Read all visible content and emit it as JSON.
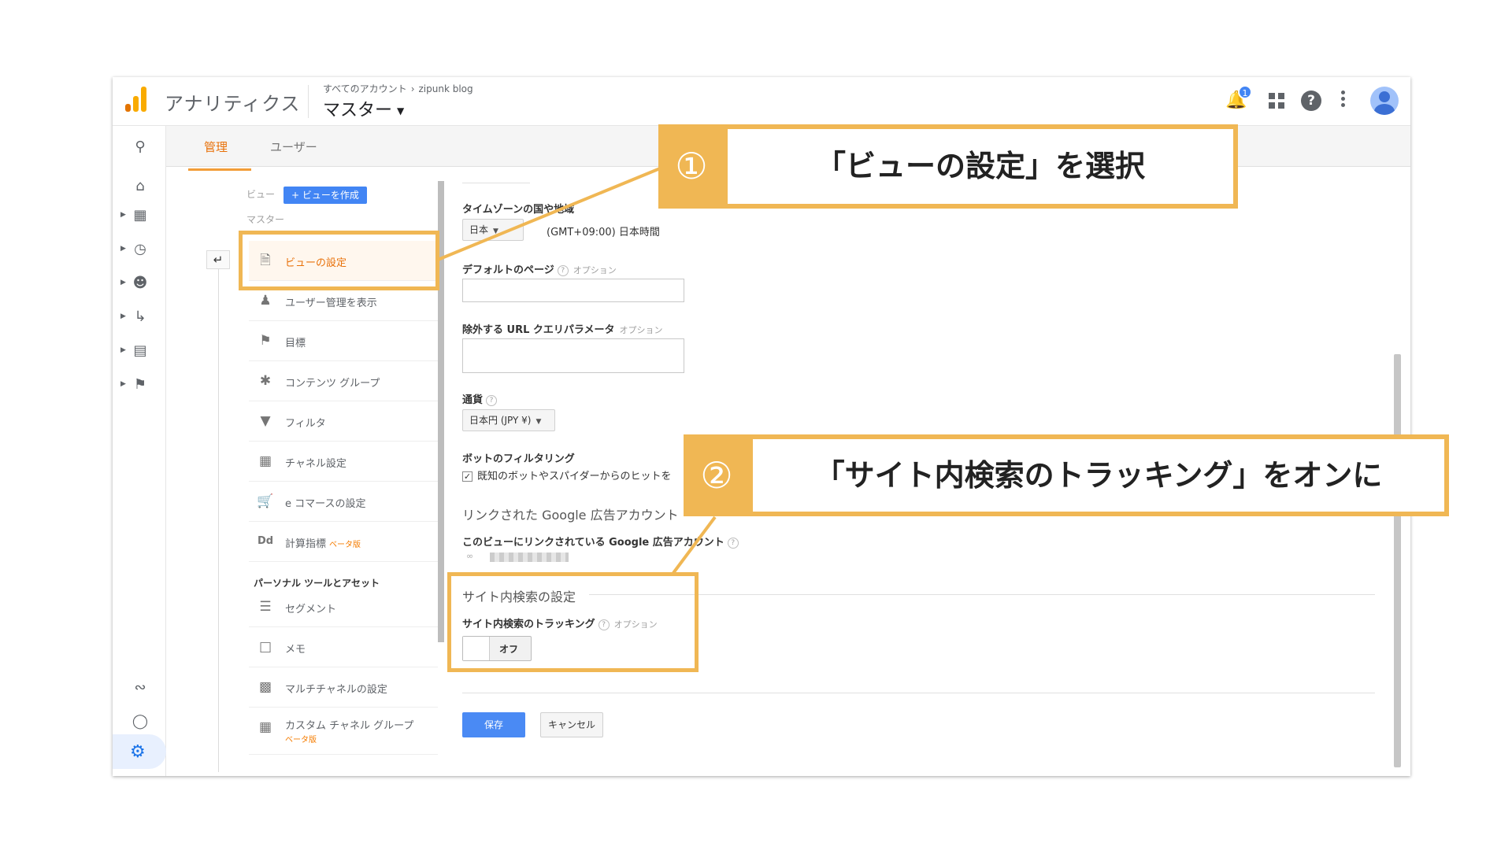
{
  "header": {
    "app_name": "アナリティクス",
    "breadcrumb_root": "すべてのアカウント",
    "breadcrumb_chev": "›",
    "breadcrumb_account": "zipunk blog",
    "view_name": "マスター",
    "notification_count": "1"
  },
  "tabs": {
    "admin": "管理",
    "user": "ユーザー"
  },
  "views": {
    "label": "ビュー",
    "create_button": "+ ビューを作成",
    "selected_view": "マスター"
  },
  "menu": {
    "items": [
      {
        "label": "ビューの設定",
        "icon": "document-icon"
      },
      {
        "label": "ユーザー管理を表示",
        "icon": "people-icon"
      },
      {
        "label": "目標",
        "icon": "flag-icon"
      },
      {
        "label": "コンテンツ グループ",
        "icon": "content-group-icon"
      },
      {
        "label": "フィルタ",
        "icon": "filter-icon"
      },
      {
        "label": "チャネル設定",
        "icon": "channel-icon"
      },
      {
        "label": "e コマースの設定",
        "icon": "cart-icon"
      },
      {
        "label": "計算指標",
        "icon": "dd-icon",
        "badge": "ベータ版"
      }
    ],
    "section_title": "パーソナル ツールとアセット",
    "personal_items": [
      {
        "label": "セグメント",
        "icon": "segment-icon"
      },
      {
        "label": "メモ",
        "icon": "memo-icon"
      },
      {
        "label": "マルチチャネルの設定",
        "icon": "bar-chart-icon"
      },
      {
        "label": "カスタム チャネル グループ",
        "icon": "channel-icon",
        "badge": "ベータ版"
      }
    ]
  },
  "form": {
    "timezone_label": "タイムゾーンの国や地域",
    "timezone_country": "日本",
    "timezone_value": "(GMT+09:00) 日本時間",
    "default_page_label": "デフォルトのページ",
    "option": "オプション",
    "exclude_url_label": "除外する URL クエリパラメータ",
    "currency_label": "通貨",
    "currency_value": "日本円 (JPY ¥)",
    "bot_filter_label": "ボットのフィルタリング",
    "bot_filter_checkbox": "既知のボットやスパイダーからのヒットを",
    "bot_filter_checked": true,
    "linked_ads_heading": "リンクされた Google 広告アカウント",
    "linked_ads_label": "このビューにリンクされている Google 広告アカウント",
    "site_search_heading": "サイト内検索の設定",
    "site_search_tracking_label": "サイト内検索のトラッキング",
    "site_search_toggle": "オフ",
    "save_button": "保存",
    "cancel_button": "キャンセル"
  },
  "annotations": {
    "step1_num": "①",
    "step1_text": "「ビューの設定」を選択",
    "step2_num": "②",
    "step2_text": "「サイト内検索のトラッキング」をオンに"
  },
  "colors": {
    "annotation": "#f0b754",
    "accent_blue": "#4285f4",
    "active_orange": "#e8710a"
  }
}
